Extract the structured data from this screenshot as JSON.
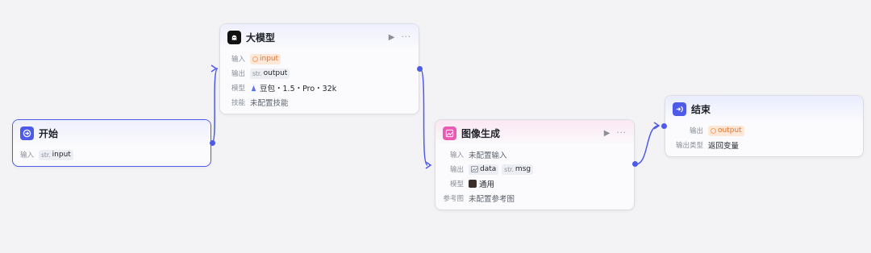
{
  "colors": {
    "accent": "#4e5ae8",
    "canvas": "#f3f3f5",
    "orange_tag": "#e5722a"
  },
  "start_node": {
    "title": "开始",
    "icon": "start-icon",
    "input_label": "输入",
    "input_type": "str.",
    "input_name": "input"
  },
  "llm_node": {
    "title": "大模型",
    "icon": "llm-ghost-icon",
    "input_label": "输入",
    "input_name": "input",
    "output_label": "输出",
    "output_type": "str.",
    "output_name": "output",
    "model_label": "模型",
    "model_value": "豆包・1.5・Pro・32k",
    "skills_label": "技能",
    "skills_value": "未配置技能"
  },
  "image_node": {
    "title": "图像生成",
    "icon": "image-generation-icon",
    "input_label": "输入",
    "input_value": "未配置输入",
    "output_label": "输出",
    "output_a_name": "data",
    "output_b_type": "str.",
    "output_b_name": "msg",
    "model_label": "模型",
    "model_value": "通用",
    "reference_label": "参考图",
    "reference_value": "未配置参考图"
  },
  "end_node": {
    "title": "结束",
    "icon": "end-icon",
    "output_label": "输出",
    "output_name": "output",
    "output_type_label": "输出类型",
    "output_type_value": "返回变量"
  }
}
